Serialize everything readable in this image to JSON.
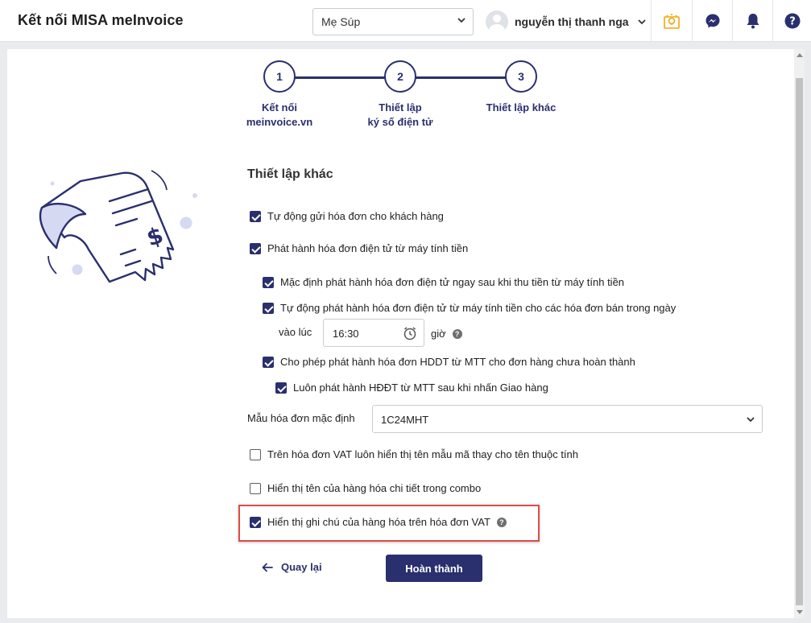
{
  "header": {
    "title": "Kết nối MISA meInvoice",
    "shop_selected": "Mẹ Súp",
    "user_name": "nguyễn thị thanh nga"
  },
  "icons": {
    "tip": "lightbulb-icon",
    "chat": "messenger-icon",
    "notify": "bell-icon",
    "help": "question-icon",
    "accent": "#2a2f6e",
    "highlight": "#e04b4b"
  },
  "stepper": {
    "steps": [
      {
        "number": "1",
        "label_line1": "Kết nối",
        "label_line2": "meinvoice.vn"
      },
      {
        "number": "2",
        "label_line1": "Thiết lập",
        "label_line2": "ký số điện tử"
      },
      {
        "number": "3",
        "label_line1": "Thiết lập khác",
        "label_line2": ""
      }
    ],
    "current_step": 3
  },
  "section": {
    "title": "Thiết lập khác"
  },
  "options": {
    "auto_send": {
      "label": "Tự động gửi hóa đơn cho khách hàng",
      "checked": true
    },
    "issue_from_pos": {
      "label": "Phát hành hóa đơn điện tử từ máy tính tiền",
      "checked": true
    },
    "default_issue_after_pay": {
      "label": "Mặc định phát hành hóa đơn điện tử ngay sau khi thu tiền từ máy tính tiền",
      "checked": true
    },
    "auto_issue_daily": {
      "label": "Tự động phát hành hóa đơn điện tử từ máy tính tiền cho các hóa đơn bán trong ngày",
      "checked": true
    },
    "time_prefix": "vào lúc",
    "time_value": "16:30",
    "time_suffix": "giờ",
    "allow_incomplete": {
      "label": "Cho phép phát hành hóa đơn HDDT từ MTT cho đơn hàng chưa hoàn thành",
      "checked": true
    },
    "always_on_delivery": {
      "label": "Luôn phát hành HĐĐT từ MTT sau khi nhấn Giao hàng",
      "checked": true
    },
    "template_label": "Mẫu hóa đơn mặc định",
    "template_value": "1C24MHT",
    "vat_show_template_code": {
      "label": "Trên hóa đơn VAT luôn hiển thị tên mẫu mã thay cho tên thuộc tính",
      "checked": false
    },
    "show_combo_items": {
      "label": "Hiển thị tên của hàng hóa chi tiết trong combo",
      "checked": false
    },
    "show_item_notes": {
      "label": "Hiển thị ghi chú của hàng hóa trên hóa đơn VAT",
      "checked": true
    }
  },
  "actions": {
    "back_label": "Quay lại",
    "finish_label": "Hoàn thành"
  }
}
